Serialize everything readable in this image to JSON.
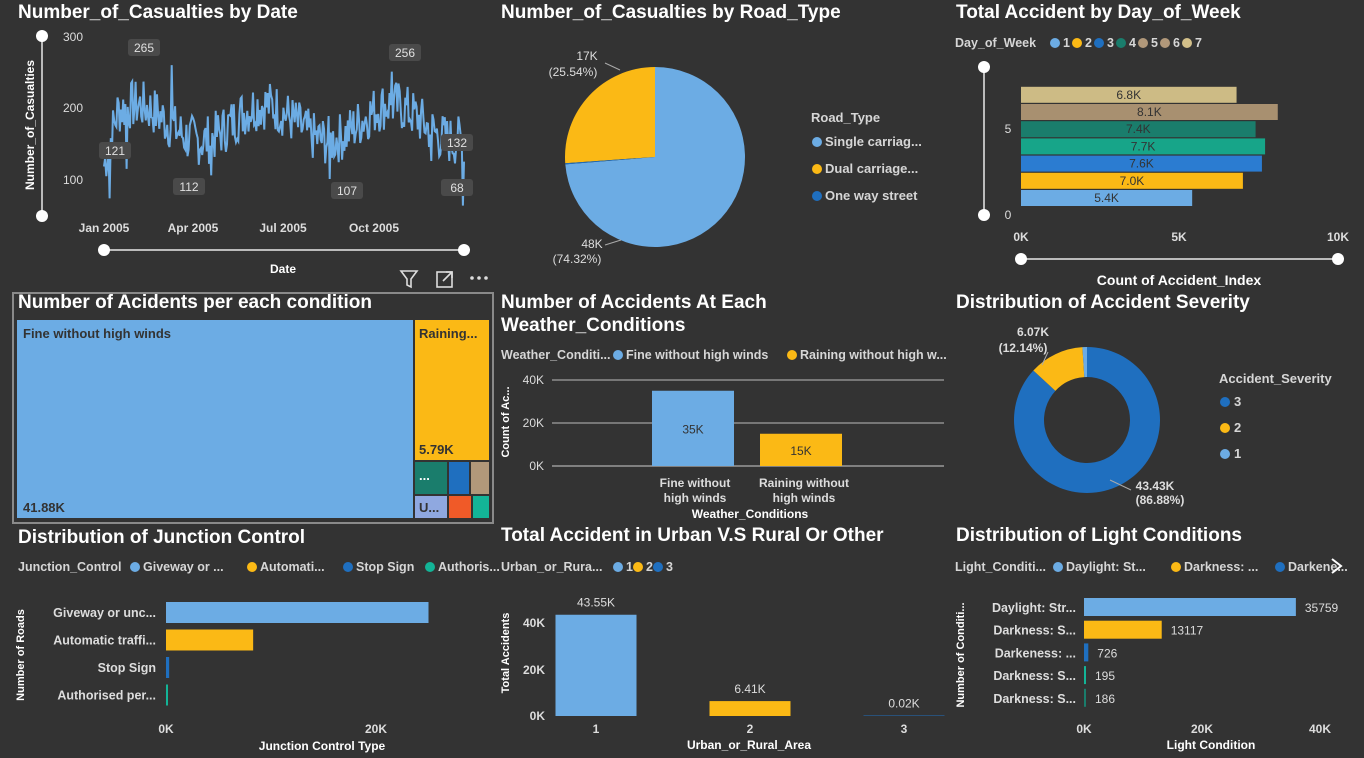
{
  "colors": {
    "light_blue": "#6CACE4",
    "yellow": "#FBB915",
    "dark_blue": "#1F6FBF",
    "teal": "#1A7D6C",
    "taupe": "#B1987A",
    "tan": "#D3C08A",
    "orange": "#F05A28",
    "green": "#13B497"
  },
  "visual_header_icons": [
    "filter-icon",
    "focus-mode-icon",
    "more-options-icon"
  ],
  "casualties_by_date": {
    "title": "Number_of_Casualties by Date",
    "ylabel": "Number_of_Casualties",
    "xlabel": "Date",
    "y_ticks": [
      "300",
      "200",
      "100"
    ],
    "x_ticks": [
      "Jan 2005",
      "Apr 2005",
      "Jul 2005",
      "Oct 2005"
    ],
    "labels": [
      "265",
      "121",
      "112",
      "107",
      "256",
      "132",
      "68"
    ]
  },
  "road_type": {
    "title": "Number_of_Casualties by Road_Type",
    "legend_title": "Road_Type",
    "legend": [
      "Single carriag...",
      "Dual carriage...",
      "One way street"
    ],
    "slice_labels": [
      {
        "value": "17K",
        "pct": "(25.54%)"
      },
      {
        "value": "48K",
        "pct": "(74.32%)"
      }
    ]
  },
  "day_of_week": {
    "title": "Total Accident by Day_of_Week",
    "legend_title": "Day_of_Week",
    "legend": [
      "1",
      "2",
      "3",
      "4",
      "5",
      "6",
      "7"
    ],
    "xlabel": "Count of Accident_Index",
    "x_ticks": [
      "0K",
      "5K",
      "10K"
    ],
    "y_ticks": [
      "5",
      "0"
    ],
    "bars": [
      "6.8K",
      "8.1K",
      "7.4K",
      "7.7K",
      "7.6K",
      "7.0K",
      "5.4K"
    ]
  },
  "conditions_treemap": {
    "title": "Number of Acidents per each condition",
    "big_label": "Fine without high winds",
    "big_value": "41.88K",
    "second_label": "Raining...",
    "second_value": "5.79K",
    "small_labels": [
      "...",
      "U..."
    ]
  },
  "weather": {
    "title_line1": "Number of Accidents At Each",
    "title_line2": "Weather_Conditions",
    "legend_title": "Weather_Conditi...",
    "legend": [
      "Fine without high winds",
      "Raining without high w..."
    ],
    "ylabel": "Count of Ac...",
    "xlabel": "Weather_Conditions",
    "y_ticks": [
      "40K",
      "20K",
      "0K"
    ],
    "bar_values": [
      "35K",
      "15K"
    ],
    "categories": [
      [
        "Fine without",
        "high winds"
      ],
      [
        "Raining without",
        "high winds"
      ]
    ]
  },
  "severity": {
    "title": "Distribution of Accident Severity",
    "legend_title": "Accident_Severity",
    "legend": [
      "3",
      "2",
      "1"
    ],
    "label_small": {
      "value": "6.07K",
      "pct": "(12.14%)"
    },
    "label_big": {
      "value": "43.43K",
      "pct": "(86.88%)"
    }
  },
  "junction": {
    "title": "Distribution of Junction Control",
    "legend_title": "Junction_Control",
    "legend": [
      "Giveway or ...",
      "Automati...",
      "Stop Sign",
      "Authoris..."
    ],
    "ylabel": "Number of Roads",
    "xlabel": "Junction Control Type",
    "x_ticks": [
      "0K",
      "20K"
    ],
    "categories": [
      "Giveway or unc...",
      "Automatic traffi...",
      "Stop Sign",
      "Authorised per..."
    ]
  },
  "urban_rural": {
    "title": "Total Accident in Urban V.S Rural Or Other",
    "legend_title": "Urban_or_Rura...",
    "legend": [
      "1",
      "2",
      "3"
    ],
    "ylabel": "Total Accidents",
    "xlabel": "Urban_or_Rural_Area",
    "y_ticks": [
      "40K",
      "20K",
      "0K"
    ],
    "categories": [
      "1",
      "2",
      "3"
    ],
    "bar_values": [
      "43.55K",
      "6.41K",
      "0.02K"
    ]
  },
  "light": {
    "title": "Distribution of Light Conditions",
    "legend_title": "Light_Conditi...",
    "legend": [
      "Daylight: St...",
      "Darkness: ...",
      "Darkene..."
    ],
    "ylabel": "Number of Conditi...",
    "xlabel": "Light Condition",
    "x_ticks": [
      "0K",
      "20K",
      "40K"
    ],
    "categories": [
      "Daylight: Str...",
      "Darkness: S...",
      "Darkeness: ...",
      "Darkness: S...",
      "Darkness: S..."
    ],
    "bar_values": [
      "35759",
      "13117",
      "726",
      "195",
      "186"
    ]
  },
  "chart_data": [
    {
      "type": "line",
      "title": "Number_of_Casualties by Date",
      "xlabel": "Date",
      "ylabel": "Number_of_Casualties",
      "ylim": [
        60,
        300
      ],
      "x": [
        "Jan 2005",
        "Apr 2005",
        "Jul 2005",
        "Oct 2005"
      ],
      "annotated_values": [
        265,
        121,
        112,
        107,
        256,
        132,
        68
      ]
    },
    {
      "type": "pie",
      "title": "Number_of_Casualties by Road_Type",
      "categories": [
        "Single carriag...",
        "Dual carriage...",
        "One way street"
      ],
      "values": [
        48000,
        17000,
        140
      ],
      "percents": [
        74.32,
        25.54,
        0.14
      ]
    },
    {
      "type": "bar",
      "title": "Total Accident by Day_of_Week",
      "xlabel": "Count of Accident_Index",
      "categories": [
        "1",
        "2",
        "3",
        "4",
        "5",
        "6",
        "7"
      ],
      "values": [
        5400,
        7000,
        7600,
        7700,
        7400,
        8100,
        6800
      ],
      "xlim": [
        0,
        10000
      ]
    },
    {
      "type": "heatmap",
      "title": "Number of Acidents per each condition",
      "categories": [
        "Fine without high winds",
        "Raining..."
      ],
      "values": [
        41880,
        5790
      ]
    },
    {
      "type": "bar",
      "title": "Number of Accidents At Each Weather_Conditions",
      "categories": [
        "Fine without high winds",
        "Raining without high winds"
      ],
      "values": [
        35000,
        15000
      ],
      "ylim": [
        0,
        40000
      ]
    },
    {
      "type": "pie",
      "title": "Distribution of Accident Severity",
      "categories": [
        "3",
        "2",
        "1"
      ],
      "values": [
        43430,
        6070,
        500
      ],
      "percents": [
        86.88,
        12.14,
        0.98
      ]
    },
    {
      "type": "bar",
      "title": "Distribution of Junction Control",
      "xlabel": "Junction Control Type",
      "ylabel": "Number of Roads",
      "categories": [
        "Giveway or unc...",
        "Automatic traffi...",
        "Stop Sign",
        "Authorised per..."
      ],
      "values": [
        25000,
        8300,
        300,
        100
      ]
    },
    {
      "type": "bar",
      "title": "Total Accident in Urban V.S Rural Or Other",
      "xlabel": "Urban_or_Rural_Area",
      "ylabel": "Total Accidents",
      "categories": [
        "1",
        "2",
        "3"
      ],
      "values": [
        43550,
        6410,
        20
      ],
      "ylim": [
        0,
        45000
      ]
    },
    {
      "type": "bar",
      "title": "Distribution of Light Conditions",
      "xlabel": "Light Condition",
      "categories": [
        "Daylight: Str...",
        "Darkness: S...",
        "Darkeness: ...",
        "Darkness: S...",
        "Darkness: S..."
      ],
      "values": [
        35759,
        13117,
        726,
        195,
        186
      ],
      "xlim": [
        0,
        40000
      ]
    }
  ]
}
